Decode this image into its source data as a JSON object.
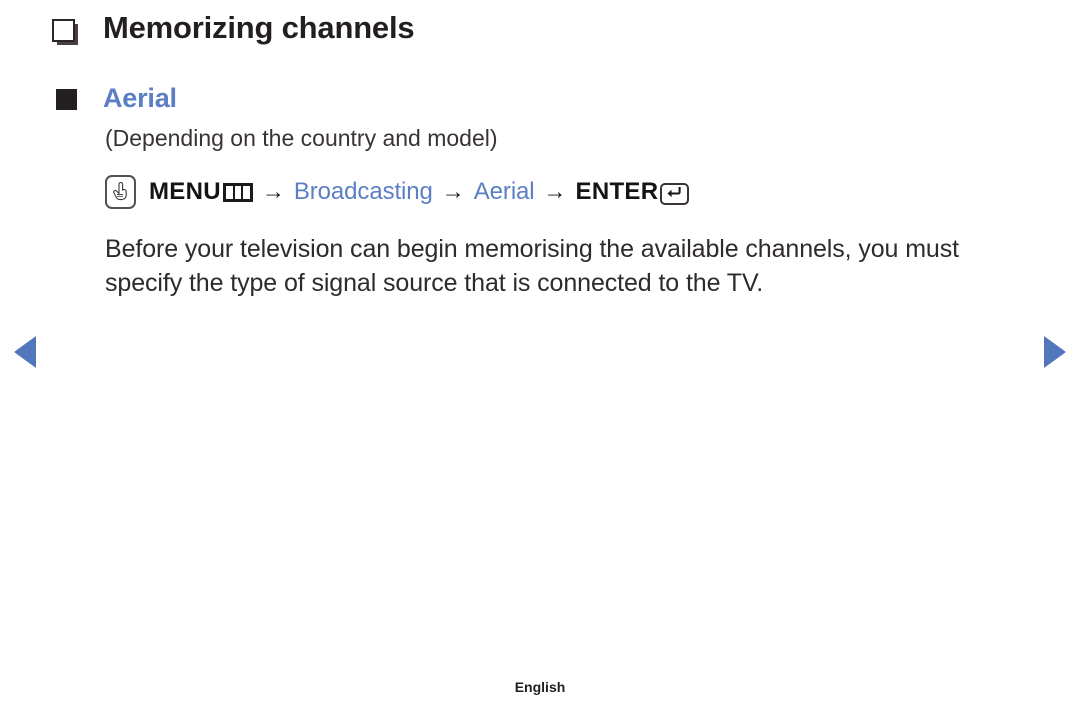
{
  "page": {
    "title": "Memorizing channels",
    "title_bullet": "hollow-square-bullet"
  },
  "section": {
    "heading": "Aerial",
    "heading_bullet": "solid-square-bullet",
    "subnote": "(Depending on the country and model)",
    "accent_color": "#5b7fc4"
  },
  "menu_path": {
    "touch_icon": "touch-gesture-icon",
    "menu_label": "MENU",
    "menu_glyph": "menu-grid-icon",
    "arrow1": "→",
    "broadcasting_label": "Broadcasting",
    "arrow2": "→",
    "aerial_label": "Aerial",
    "arrow3": "→",
    "enter_label": "ENTER",
    "enter_glyph": "return-key-icon"
  },
  "body": {
    "paragraph": "Before your television can begin memorising the available channels, you must specify the type of signal source that is connected to the TV."
  },
  "navigation": {
    "prev_icon": "triangle-left-icon",
    "next_icon": "triangle-right-icon",
    "arrow_color": "#5277bd"
  },
  "footer": {
    "language": "English"
  }
}
